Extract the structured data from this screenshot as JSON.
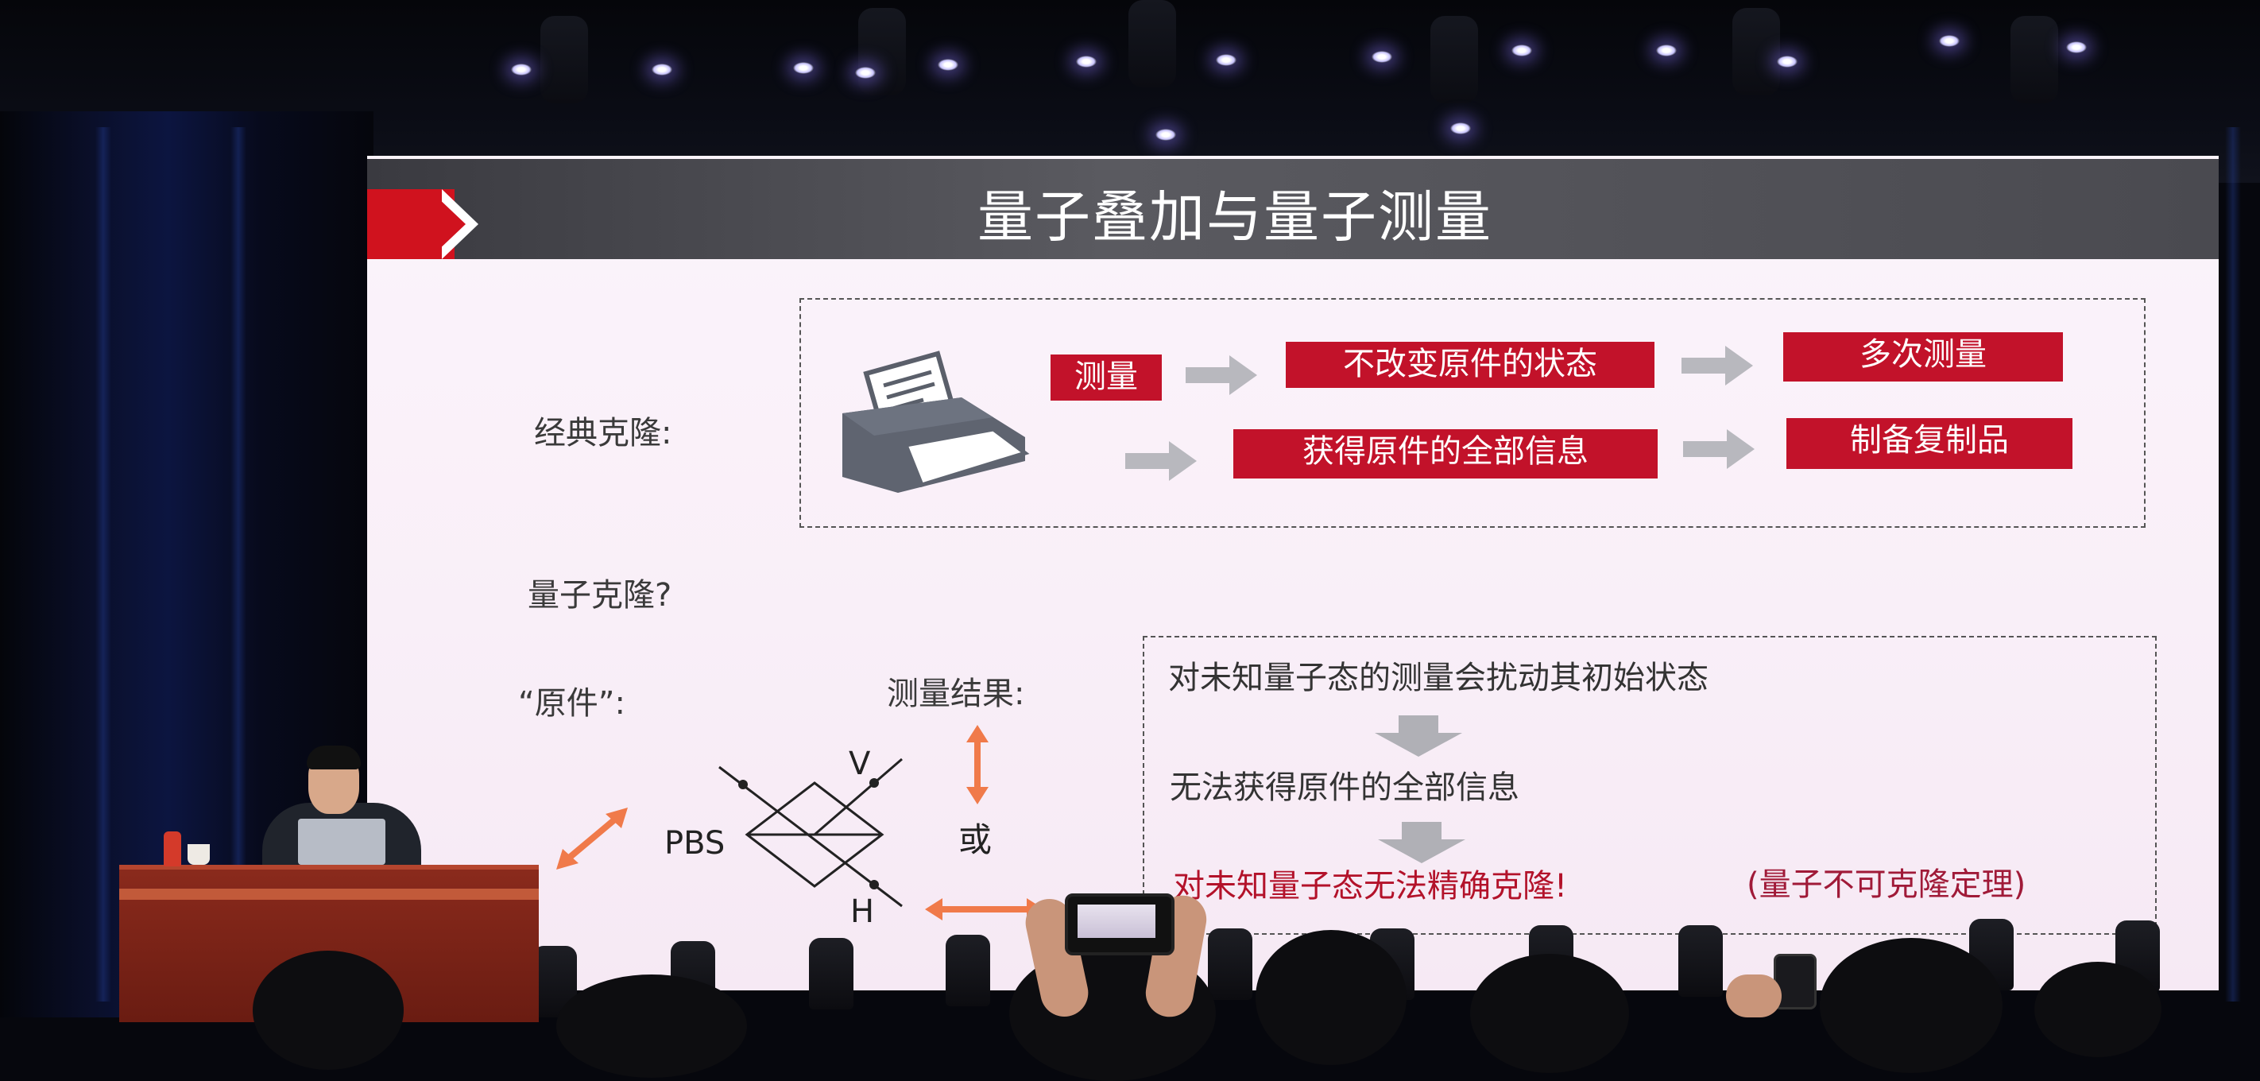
{
  "slide": {
    "title": "量子叠加与量子测量",
    "classical_clone": {
      "label": "经典克隆:",
      "row1": [
        "测量",
        "不改变原件的状态",
        "多次测量"
      ],
      "row2": [
        "获得原件的全部信息",
        "制备复制品"
      ]
    },
    "quantum_clone_label": "量子克隆?",
    "original_label": "“原件”:",
    "measure_result_label": "测量结果:",
    "pbs_label": "PBS",
    "v_label": "V",
    "h_label": "H",
    "or_label": "或",
    "conclusion": {
      "line1": "对未知量子态的测量会扰动其初始状态",
      "line2": "无法获得原件的全部信息",
      "line3": "对未知量子态无法精确克隆!",
      "line3_note": "(量子不可克隆定理)"
    }
  },
  "colors": {
    "accent_red": "#c2122a",
    "orange_arrow": "#f07a4a",
    "title_bar": "#4a4a50"
  },
  "icons": [
    "printer-icon",
    "gray-right-arrow-icon",
    "gray-down-arrow-icon",
    "orange-double-arrow-icon"
  ]
}
